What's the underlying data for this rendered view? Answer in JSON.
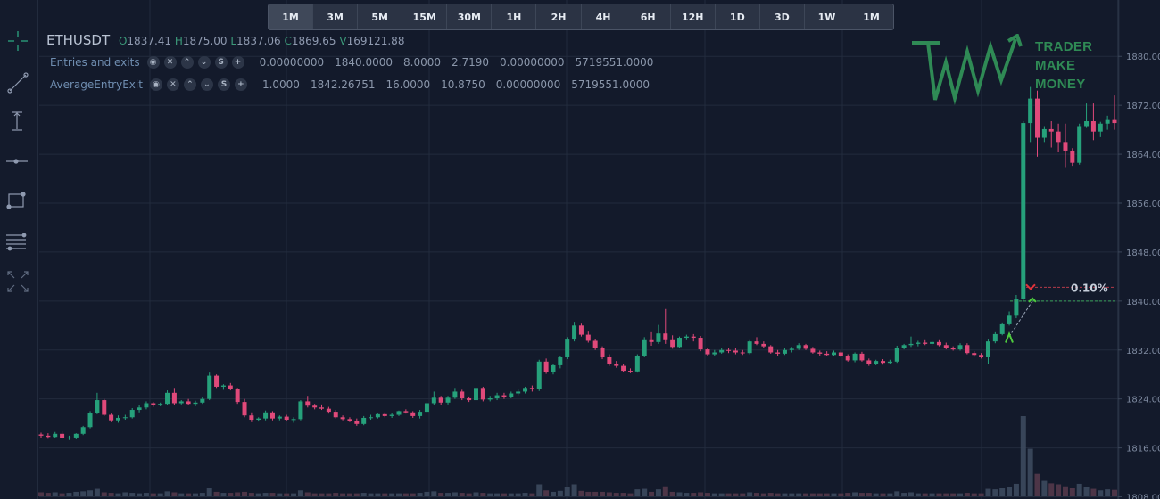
{
  "timeframes": [
    {
      "label": "1M",
      "active": true
    },
    {
      "label": "3M"
    },
    {
      "label": "5M"
    },
    {
      "label": "15M"
    },
    {
      "label": "30M"
    },
    {
      "label": "1H"
    },
    {
      "label": "2H"
    },
    {
      "label": "4H"
    },
    {
      "label": "6H"
    },
    {
      "label": "12H"
    },
    {
      "label": "1D"
    },
    {
      "label": "3D"
    },
    {
      "label": "1W"
    },
    {
      "label": "1M"
    }
  ],
  "tools": [
    "crosshair-icon",
    "trendline-icon",
    "vertical-measure-icon",
    "horizontal-line-icon",
    "rectangle-icon",
    "fib-levels-icon",
    "fullscreen-icon"
  ],
  "legend": {
    "symbol": "ETHUSDT",
    "o_label": "O",
    "open": "1837.41",
    "h_label": "H",
    "high": "1875.00",
    "l_label": "L",
    "low": "1837.06",
    "c_label": "C",
    "close": "1869.65",
    "v_label": "V",
    "volume": "169121.88"
  },
  "indicators": [
    {
      "name": "Entries and exits",
      "values": [
        "0.00000000",
        "1840.0000",
        "8.0000",
        "2.7190",
        "0.00000000",
        "5719551.0000"
      ]
    },
    {
      "name": "AverageEntryExit",
      "values": [
        "1.0000",
        "1842.26751",
        "16.0000",
        "10.8750",
        "0.00000000",
        "5719551.0000"
      ]
    }
  ],
  "indicator_buttons": [
    "eye-icon",
    "close-icon",
    "chevron-up-icon",
    "chevron-down-icon",
    "settings-icon",
    "add-icon"
  ],
  "indicator_button_glyphs": [
    "◉",
    "✕",
    "⌃",
    "⌄",
    "S",
    "+"
  ],
  "logo": {
    "line1": "TRADER",
    "line2": "MAKE",
    "line3": "MONEY",
    "color": "#2f8a55"
  },
  "trade_label": "0.10%",
  "colors": {
    "up": "#26a17b",
    "down": "#e0497a",
    "bg": "#131a2b",
    "grid": "#222b3d",
    "volume": "#3a4558"
  },
  "chart_data": {
    "type": "candlestick",
    "symbol": "ETHUSDT",
    "yticks": [
      1808.0,
      1816.0,
      1824.0,
      1832.0,
      1840.0,
      1848.0,
      1856.0,
      1864.0,
      1872.0,
      1880.0
    ],
    "ylim": [
      1808,
      1883
    ],
    "candles": [
      [
        1818.2,
        1818.5,
        1817.6,
        1818.0
      ],
      [
        1818.0,
        1818.4,
        1817.5,
        1817.8
      ],
      [
        1817.8,
        1818.6,
        1817.6,
        1818.3
      ],
      [
        1818.3,
        1818.7,
        1817.5,
        1817.6
      ],
      [
        1817.6,
        1818.0,
        1817.3,
        1817.7
      ],
      [
        1817.7,
        1818.4,
        1817.4,
        1818.3
      ],
      [
        1818.3,
        1819.6,
        1818.1,
        1819.4
      ],
      [
        1819.4,
        1822.0,
        1819.2,
        1821.7
      ],
      [
        1821.7,
        1825.0,
        1821.5,
        1823.8
      ],
      [
        1823.8,
        1824.0,
        1821.2,
        1821.4
      ],
      [
        1821.4,
        1821.6,
        1820.2,
        1820.5
      ],
      [
        1820.5,
        1821.3,
        1820.1,
        1820.9
      ],
      [
        1820.9,
        1821.4,
        1820.6,
        1821.0
      ],
      [
        1821.0,
        1822.5,
        1820.8,
        1822.2
      ],
      [
        1822.2,
        1823.0,
        1821.8,
        1822.6
      ],
      [
        1822.6,
        1823.6,
        1822.3,
        1823.3
      ],
      [
        1823.3,
        1823.5,
        1822.7,
        1823.0
      ],
      [
        1823.0,
        1823.4,
        1822.8,
        1823.2
      ],
      [
        1823.2,
        1825.4,
        1823.0,
        1825.0
      ],
      [
        1825.0,
        1825.8,
        1823.0,
        1823.3
      ],
      [
        1823.3,
        1823.8,
        1823.1,
        1823.6
      ],
      [
        1823.6,
        1824.0,
        1823.0,
        1823.2
      ],
      [
        1823.2,
        1823.7,
        1822.8,
        1823.4
      ],
      [
        1823.4,
        1824.3,
        1823.2,
        1824.0
      ],
      [
        1824.0,
        1828.3,
        1823.8,
        1827.8
      ],
      [
        1827.8,
        1828.0,
        1825.8,
        1826.0
      ],
      [
        1826.0,
        1826.4,
        1825.5,
        1826.2
      ],
      [
        1826.2,
        1826.6,
        1825.4,
        1825.6
      ],
      [
        1825.6,
        1825.8,
        1823.2,
        1823.5
      ],
      [
        1823.5,
        1824.0,
        1821.0,
        1821.3
      ],
      [
        1821.3,
        1821.8,
        1820.2,
        1820.6
      ],
      [
        1820.6,
        1821.0,
        1820.3,
        1820.8
      ],
      [
        1820.8,
        1822.1,
        1820.5,
        1821.8
      ],
      [
        1821.8,
        1822.0,
        1820.5,
        1820.8
      ],
      [
        1820.8,
        1821.3,
        1820.5,
        1821.1
      ],
      [
        1821.1,
        1821.4,
        1820.4,
        1820.6
      ],
      [
        1820.6,
        1821.0,
        1820.1,
        1820.7
      ],
      [
        1820.7,
        1823.8,
        1820.5,
        1823.6
      ],
      [
        1823.6,
        1824.5,
        1822.6,
        1822.9
      ],
      [
        1822.9,
        1823.2,
        1822.3,
        1822.6
      ],
      [
        1822.6,
        1823.1,
        1822.2,
        1822.4
      ],
      [
        1822.4,
        1822.7,
        1821.6,
        1821.9
      ],
      [
        1821.9,
        1822.2,
        1820.8,
        1821.0
      ],
      [
        1821.0,
        1821.3,
        1820.5,
        1820.7
      ],
      [
        1820.7,
        1821.0,
        1820.2,
        1820.4
      ],
      [
        1820.4,
        1820.8,
        1819.6,
        1819.9
      ],
      [
        1819.9,
        1821.2,
        1819.7,
        1820.9
      ],
      [
        1820.9,
        1821.4,
        1820.6,
        1821.0
      ],
      [
        1821.0,
        1821.6,
        1820.8,
        1821.5
      ],
      [
        1821.5,
        1821.8,
        1821.0,
        1821.2
      ],
      [
        1821.2,
        1821.7,
        1820.9,
        1821.4
      ],
      [
        1821.4,
        1822.1,
        1821.2,
        1822.0
      ],
      [
        1822.0,
        1822.3,
        1821.6,
        1821.8
      ],
      [
        1821.8,
        1822.0,
        1820.9,
        1821.2
      ],
      [
        1821.2,
        1822.2,
        1820.8,
        1821.9
      ],
      [
        1821.9,
        1823.6,
        1821.7,
        1823.3
      ],
      [
        1823.3,
        1825.2,
        1823.0,
        1824.2
      ],
      [
        1824.2,
        1824.5,
        1823.0,
        1823.4
      ],
      [
        1823.4,
        1824.5,
        1823.1,
        1824.2
      ],
      [
        1824.2,
        1825.8,
        1824.0,
        1825.2
      ],
      [
        1825.2,
        1825.5,
        1823.8,
        1824.1
      ],
      [
        1824.1,
        1824.4,
        1823.5,
        1823.8
      ],
      [
        1823.8,
        1826.1,
        1823.6,
        1825.8
      ],
      [
        1825.8,
        1826.0,
        1823.6,
        1823.9
      ],
      [
        1823.9,
        1824.5,
        1823.6,
        1824.1
      ],
      [
        1824.1,
        1825.0,
        1823.8,
        1824.6
      ],
      [
        1824.6,
        1825.0,
        1824.0,
        1824.3
      ],
      [
        1824.3,
        1825.2,
        1824.1,
        1824.9
      ],
      [
        1824.9,
        1825.6,
        1824.6,
        1825.2
      ],
      [
        1825.2,
        1826.0,
        1824.9,
        1825.8
      ],
      [
        1825.8,
        1826.2,
        1825.2,
        1825.6
      ],
      [
        1825.6,
        1830.4,
        1825.3,
        1830.1
      ],
      [
        1830.1,
        1830.6,
        1828.1,
        1828.4
      ],
      [
        1828.4,
        1829.7,
        1828.0,
        1829.5
      ],
      [
        1829.5,
        1831.0,
        1829.0,
        1830.8
      ],
      [
        1830.8,
        1834.1,
        1830.5,
        1833.7
      ],
      [
        1833.7,
        1836.6,
        1833.4,
        1836.0
      ],
      [
        1836.0,
        1836.3,
        1834.2,
        1834.5
      ],
      [
        1834.5,
        1835.0,
        1833.2,
        1833.5
      ],
      [
        1833.5,
        1833.8,
        1832.0,
        1832.3
      ],
      [
        1832.3,
        1832.6,
        1830.5,
        1830.8
      ],
      [
        1830.8,
        1831.3,
        1829.4,
        1829.7
      ],
      [
        1829.7,
        1830.2,
        1829.1,
        1829.4
      ],
      [
        1829.4,
        1829.7,
        1828.4,
        1828.6
      ],
      [
        1828.6,
        1829.0,
        1828.2,
        1828.5
      ],
      [
        1828.5,
        1831.3,
        1828.3,
        1831.0
      ],
      [
        1831.0,
        1834.1,
        1830.8,
        1833.6
      ],
      [
        1833.6,
        1834.9,
        1832.7,
        1833.3
      ],
      [
        1833.3,
        1836.1,
        1833.0,
        1834.7
      ],
      [
        1834.7,
        1838.7,
        1833.0,
        1833.6
      ],
      [
        1833.6,
        1834.4,
        1832.2,
        1832.5
      ],
      [
        1832.5,
        1834.2,
        1832.3,
        1834.0
      ],
      [
        1834.0,
        1834.5,
        1833.6,
        1834.2
      ],
      [
        1834.2,
        1834.6,
        1833.4,
        1834.0
      ],
      [
        1834.0,
        1834.3,
        1831.8,
        1832.1
      ],
      [
        1832.1,
        1832.4,
        1831.0,
        1831.3
      ],
      [
        1831.3,
        1832.0,
        1831.0,
        1831.6
      ],
      [
        1831.6,
        1832.3,
        1831.4,
        1832.0
      ],
      [
        1832.0,
        1832.4,
        1831.5,
        1831.9
      ],
      [
        1831.9,
        1832.3,
        1831.3,
        1831.6
      ],
      [
        1831.6,
        1832.0,
        1831.2,
        1831.5
      ],
      [
        1831.5,
        1833.6,
        1831.3,
        1833.4
      ],
      [
        1833.4,
        1834.1,
        1832.8,
        1833.0
      ],
      [
        1833.0,
        1833.4,
        1832.3,
        1832.6
      ],
      [
        1832.6,
        1832.8,
        1831.4,
        1831.6
      ],
      [
        1831.6,
        1832.0,
        1831.0,
        1831.4
      ],
      [
        1831.4,
        1832.3,
        1831.2,
        1832.0
      ],
      [
        1832.0,
        1832.5,
        1831.6,
        1832.2
      ],
      [
        1832.2,
        1833.1,
        1832.0,
        1832.8
      ],
      [
        1832.8,
        1833.0,
        1832.0,
        1832.2
      ],
      [
        1832.2,
        1832.5,
        1831.4,
        1831.6
      ],
      [
        1831.6,
        1831.9,
        1831.1,
        1831.4
      ],
      [
        1831.4,
        1831.8,
        1831.0,
        1831.2
      ],
      [
        1831.2,
        1831.9,
        1831.0,
        1831.6
      ],
      [
        1831.6,
        1831.9,
        1830.8,
        1831.0
      ],
      [
        1831.0,
        1831.3,
        1830.1,
        1830.3
      ],
      [
        1830.3,
        1831.6,
        1830.0,
        1831.4
      ],
      [
        1831.4,
        1831.7,
        1830.1,
        1830.3
      ],
      [
        1830.3,
        1830.6,
        1829.4,
        1829.7
      ],
      [
        1829.7,
        1830.4,
        1829.5,
        1830.2
      ],
      [
        1830.2,
        1830.5,
        1829.6,
        1829.9
      ],
      [
        1829.9,
        1830.4,
        1829.7,
        1830.1
      ],
      [
        1830.1,
        1832.7,
        1829.9,
        1832.4
      ],
      [
        1832.4,
        1833.0,
        1832.1,
        1832.8
      ],
      [
        1832.8,
        1834.2,
        1832.5,
        1833.0
      ],
      [
        1833.0,
        1833.5,
        1832.6,
        1833.2
      ],
      [
        1833.2,
        1833.6,
        1832.8,
        1833.0
      ],
      [
        1833.0,
        1833.5,
        1832.7,
        1833.3
      ],
      [
        1833.3,
        1833.6,
        1832.6,
        1832.8
      ],
      [
        1832.8,
        1833.2,
        1832.1,
        1832.3
      ],
      [
        1832.3,
        1832.6,
        1831.9,
        1832.1
      ],
      [
        1832.1,
        1833.1,
        1831.9,
        1832.8
      ],
      [
        1832.8,
        1833.1,
        1831.3,
        1831.5
      ],
      [
        1831.5,
        1831.8,
        1830.9,
        1831.2
      ],
      [
        1831.2,
        1831.5,
        1830.6,
        1830.8
      ],
      [
        1830.8,
        1833.7,
        1829.7,
        1833.4
      ],
      [
        1833.4,
        1834.9,
        1833.1,
        1834.6
      ],
      [
        1834.6,
        1836.5,
        1834.4,
        1836.2
      ],
      [
        1836.2,
        1838.3,
        1836.0,
        1837.6
      ],
      [
        1837.6,
        1841.0,
        1837.2,
        1840.3
      ],
      [
        1840.3,
        1869.4,
        1840.0,
        1869.1
      ],
      [
        1869.1,
        1875.0,
        1866.0,
        1873.1
      ],
      [
        1873.1,
        1874.4,
        1863.6,
        1866.7
      ],
      [
        1866.7,
        1868.6,
        1866.0,
        1868.1
      ],
      [
        1868.1,
        1869.4,
        1865.1,
        1867.7
      ],
      [
        1867.7,
        1869.0,
        1864.3,
        1866.0
      ],
      [
        1866.0,
        1869.0,
        1861.9,
        1864.6
      ],
      [
        1864.6,
        1865.0,
        1862.1,
        1862.6
      ],
      [
        1862.6,
        1869.0,
        1862.3,
        1868.6
      ],
      [
        1868.6,
        1872.3,
        1868.3,
        1869.4
      ],
      [
        1869.4,
        1872.3,
        1866.3,
        1867.7
      ],
      [
        1867.7,
        1869.3,
        1866.8,
        1869.0
      ],
      [
        1869.0,
        1870.3,
        1868.0,
        1869.6
      ],
      [
        1869.6,
        1873.6,
        1868.0,
        1869.1
      ]
    ],
    "volume": [
      0.8,
      0.7,
      0.8,
      0.6,
      0.7,
      0.9,
      1.0,
      1.2,
      1.5,
      0.8,
      0.7,
      0.6,
      0.8,
      0.7,
      0.6,
      0.7,
      0.6,
      0.6,
      1.0,
      0.8,
      0.6,
      0.6,
      0.6,
      0.7,
      1.6,
      0.9,
      0.7,
      0.7,
      0.8,
      0.9,
      0.7,
      0.6,
      0.7,
      0.7,
      0.6,
      0.6,
      0.6,
      1.2,
      0.8,
      0.6,
      0.6,
      0.6,
      0.7,
      0.6,
      0.6,
      0.6,
      0.7,
      0.6,
      0.6,
      0.6,
      0.6,
      0.6,
      0.6,
      0.6,
      0.7,
      0.9,
      1.0,
      0.7,
      0.7,
      0.8,
      0.7,
      0.6,
      0.8,
      0.7,
      0.6,
      0.6,
      0.6,
      0.6,
      0.6,
      0.7,
      0.6,
      2.4,
      1.2,
      0.9,
      1.1,
      1.8,
      2.4,
      1.1,
      0.9,
      0.9,
      0.9,
      0.8,
      0.7,
      0.7,
      0.6,
      1.4,
      1.5,
      0.9,
      1.4,
      2.0,
      0.9,
      0.8,
      0.7,
      0.7,
      0.8,
      0.7,
      0.6,
      0.6,
      0.6,
      0.6,
      0.6,
      0.8,
      0.7,
      0.6,
      0.7,
      0.6,
      0.6,
      0.6,
      0.6,
      0.6,
      0.6,
      0.6,
      0.6,
      0.6,
      0.6,
      0.7,
      0.8,
      0.7,
      0.7,
      0.6,
      0.6,
      0.6,
      1.0,
      0.7,
      0.8,
      0.6,
      0.6,
      0.6,
      0.6,
      0.6,
      0.6,
      0.6,
      0.7,
      0.6,
      0.6,
      1.5,
      1.4,
      1.6,
      1.9,
      2.5,
      16.0,
      9.5,
      4.5,
      3.1,
      2.6,
      2.4,
      2.0,
      1.6,
      2.5,
      1.8,
      1.5,
      1.2,
      1.4,
      1.3
    ]
  }
}
